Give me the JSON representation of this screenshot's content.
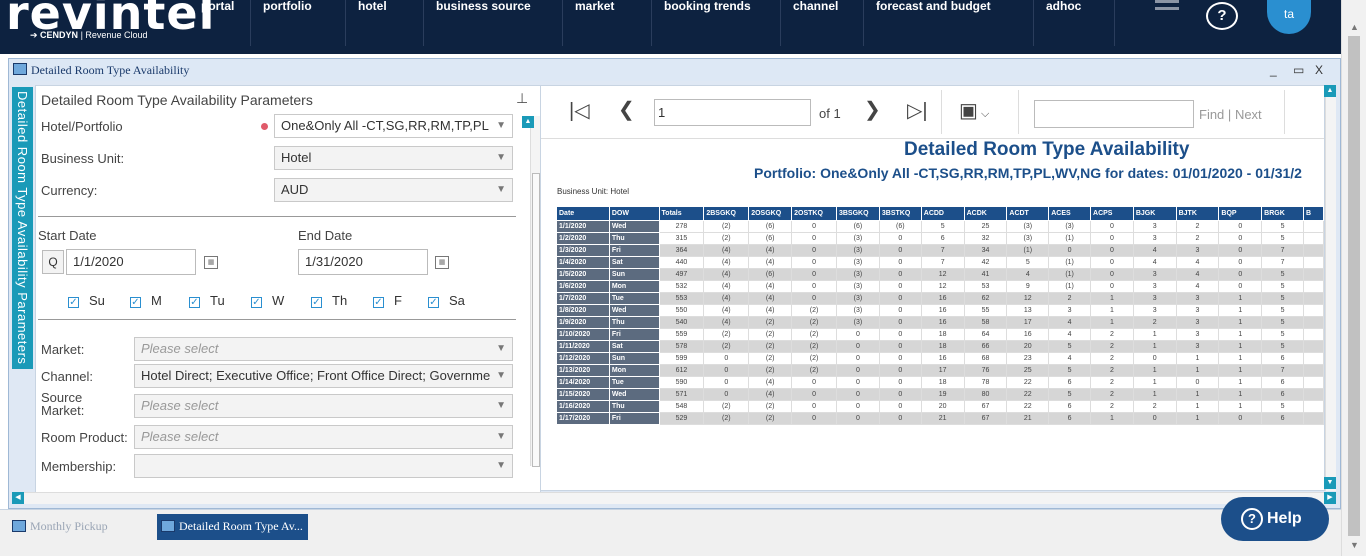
{
  "brand": {
    "logo": "revintel",
    "sub_prefix": "CENDYN",
    "sub_suffix": "| Revenue Cloud"
  },
  "nav": [
    "portal",
    "portfolio",
    "hotel",
    "business source",
    "market",
    "booking trends",
    "channel",
    "forecast and budget",
    "adhoc"
  ],
  "header": {
    "help_glyph": "?",
    "avatar_initials": "ta"
  },
  "window": {
    "title": "Detailed Room Type Availability",
    "min": "_",
    "max": "▭",
    "close": "X"
  },
  "params": {
    "vertical_tab": "Detailed Room Type Availability Parameters",
    "title": "Detailed Room Type Availability Parameters",
    "hotel_label": "Hotel/Portfolio",
    "hotel_value": "One&Only All -CT,SG,RR,RM,TP,PL",
    "bu_label": "Business Unit:",
    "bu_value": "Hotel",
    "currency_label": "Currency:",
    "currency_value": "AUD",
    "start_label": "Start Date",
    "start_value": "1/1/2020",
    "q_label": "Q",
    "end_label": "End Date",
    "end_value": "1/31/2020",
    "days": [
      "Su",
      "M",
      "Tu",
      "W",
      "Th",
      "F",
      "Sa"
    ],
    "market_label": "Market:",
    "market_value": "Please select",
    "channel_label": "Channel:",
    "channel_value": "Hotel Direct; Executive Office; Front Office Direct; Governme",
    "source_label": "Source Market:",
    "source_value": "Please select",
    "room_label": "Room Product:",
    "room_value": "Please select",
    "membership_label": "Membership:",
    "membership_value": ""
  },
  "toolbar": {
    "page": "1",
    "of": "of 1",
    "find_placeholder": "",
    "find": "Find",
    "sep": "|",
    "next": "Next"
  },
  "report": {
    "title": "Detailed Room Type Availability",
    "subtitle": "Portfolio: One&Only All -CT,SG,RR,RM,TP,PL,WV,NG for dates: 01/01/2020 - 01/31/2",
    "business_unit": "Business Unit: Hotel",
    "columns": [
      "Date",
      "DOW",
      "Totals",
      "2BSGKQ",
      "2OSGKQ",
      "2OSTKQ",
      "3BSGKQ",
      "3BSTKQ",
      "ACDD",
      "ACDK",
      "ACDT",
      "ACES",
      "ACPS",
      "BJGK",
      "BJTK",
      "BQP",
      "BRGK",
      "B"
    ],
    "rows": [
      [
        "1/1/2020",
        "Wed",
        "278",
        "(2)",
        "(6)",
        "0",
        "(6)",
        "(6)",
        "5",
        "25",
        "(3)",
        "(3)",
        "0",
        "3",
        "2",
        "0",
        "5",
        ""
      ],
      [
        "1/2/2020",
        "Thu",
        "315",
        "(2)",
        "(6)",
        "0",
        "(3)",
        "0",
        "6",
        "32",
        "(3)",
        "(1)",
        "0",
        "3",
        "2",
        "0",
        "5",
        ""
      ],
      [
        "1/3/2020",
        "Fri",
        "364",
        "(4)",
        "(4)",
        "0",
        "(3)",
        "0",
        "7",
        "34",
        "(1)",
        "0",
        "0",
        "4",
        "3",
        "0",
        "7",
        ""
      ],
      [
        "1/4/2020",
        "Sat",
        "440",
        "(4)",
        "(4)",
        "0",
        "(3)",
        "0",
        "7",
        "42",
        "5",
        "(1)",
        "0",
        "4",
        "4",
        "0",
        "7",
        ""
      ],
      [
        "1/5/2020",
        "Sun",
        "497",
        "(4)",
        "(6)",
        "0",
        "(3)",
        "0",
        "12",
        "41",
        "4",
        "(1)",
        "0",
        "3",
        "4",
        "0",
        "5",
        ""
      ],
      [
        "1/6/2020",
        "Mon",
        "532",
        "(4)",
        "(4)",
        "0",
        "(3)",
        "0",
        "12",
        "53",
        "9",
        "(1)",
        "0",
        "3",
        "4",
        "0",
        "5",
        ""
      ],
      [
        "1/7/2020",
        "Tue",
        "553",
        "(4)",
        "(4)",
        "0",
        "(3)",
        "0",
        "16",
        "62",
        "12",
        "2",
        "1",
        "3",
        "3",
        "1",
        "5",
        ""
      ],
      [
        "1/8/2020",
        "Wed",
        "550",
        "(4)",
        "(4)",
        "(2)",
        "(3)",
        "0",
        "16",
        "55",
        "13",
        "3",
        "1",
        "3",
        "3",
        "1",
        "5",
        ""
      ],
      [
        "1/9/2020",
        "Thu",
        "540",
        "(4)",
        "(2)",
        "(2)",
        "(3)",
        "0",
        "16",
        "58",
        "17",
        "4",
        "1",
        "2",
        "3",
        "1",
        "5",
        ""
      ],
      [
        "1/10/2020",
        "Fri",
        "559",
        "(2)",
        "(2)",
        "(2)",
        "0",
        "0",
        "18",
        "64",
        "16",
        "4",
        "2",
        "1",
        "3",
        "1",
        "5",
        ""
      ],
      [
        "1/11/2020",
        "Sat",
        "578",
        "(2)",
        "(2)",
        "(2)",
        "0",
        "0",
        "18",
        "66",
        "20",
        "5",
        "2",
        "1",
        "3",
        "1",
        "5",
        ""
      ],
      [
        "1/12/2020",
        "Sun",
        "599",
        "0",
        "(2)",
        "(2)",
        "0",
        "0",
        "16",
        "68",
        "23",
        "4",
        "2",
        "0",
        "1",
        "1",
        "6",
        ""
      ],
      [
        "1/13/2020",
        "Mon",
        "612",
        "0",
        "(2)",
        "(2)",
        "0",
        "0",
        "17",
        "76",
        "25",
        "5",
        "2",
        "1",
        "1",
        "1",
        "7",
        ""
      ],
      [
        "1/14/2020",
        "Tue",
        "590",
        "0",
        "(4)",
        "0",
        "0",
        "0",
        "18",
        "78",
        "22",
        "6",
        "2",
        "1",
        "0",
        "1",
        "6",
        ""
      ],
      [
        "1/15/2020",
        "Wed",
        "571",
        "0",
        "(4)",
        "0",
        "0",
        "0",
        "19",
        "80",
        "22",
        "5",
        "2",
        "1",
        "1",
        "1",
        "6",
        ""
      ],
      [
        "1/16/2020",
        "Thu",
        "548",
        "(2)",
        "(2)",
        "0",
        "0",
        "0",
        "20",
        "67",
        "22",
        "6",
        "2",
        "2",
        "1",
        "1",
        "5",
        ""
      ],
      [
        "1/17/2020",
        "Fri",
        "529",
        "(2)",
        "(2)",
        "0",
        "0",
        "0",
        "21",
        "67",
        "21",
        "6",
        "1",
        "0",
        "1",
        "0",
        "6",
        ""
      ]
    ]
  },
  "taskbar": {
    "tab1": "Monthly Pickup",
    "tab2": "Detailed Room Type Av..."
  },
  "help_button": {
    "label": "Help",
    "glyph": "?"
  }
}
